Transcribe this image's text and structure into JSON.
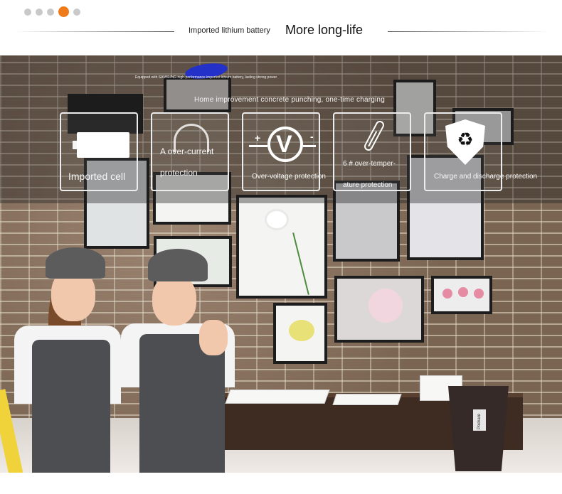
{
  "header": {
    "pagination_dots": [
      false,
      false,
      false,
      true,
      false
    ],
    "subtitle": "Imported lithium battery",
    "title": "More long-life",
    "accent_color": "#ee7a1a"
  },
  "banner": {
    "small_tagline": "Equipped with SAMSUNG high-performance imported lithium battery, lasting strong power",
    "tagline": "Home improvement concrete punching, one-time charging"
  },
  "features": [
    {
      "icon": "battery-icon",
      "label": "Imported cell"
    },
    {
      "icon": "gauge-icon",
      "label": "A over-current protection"
    },
    {
      "icon": "voltage-icon",
      "label": "Over-voltage protection"
    },
    {
      "icon": "thermometer-icon",
      "label": "6 # over-temper-ature protection"
    },
    {
      "icon": "recycle-shield-icon",
      "label": "Charge and discharge protection"
    }
  ],
  "bucket_brand": "Pockare"
}
